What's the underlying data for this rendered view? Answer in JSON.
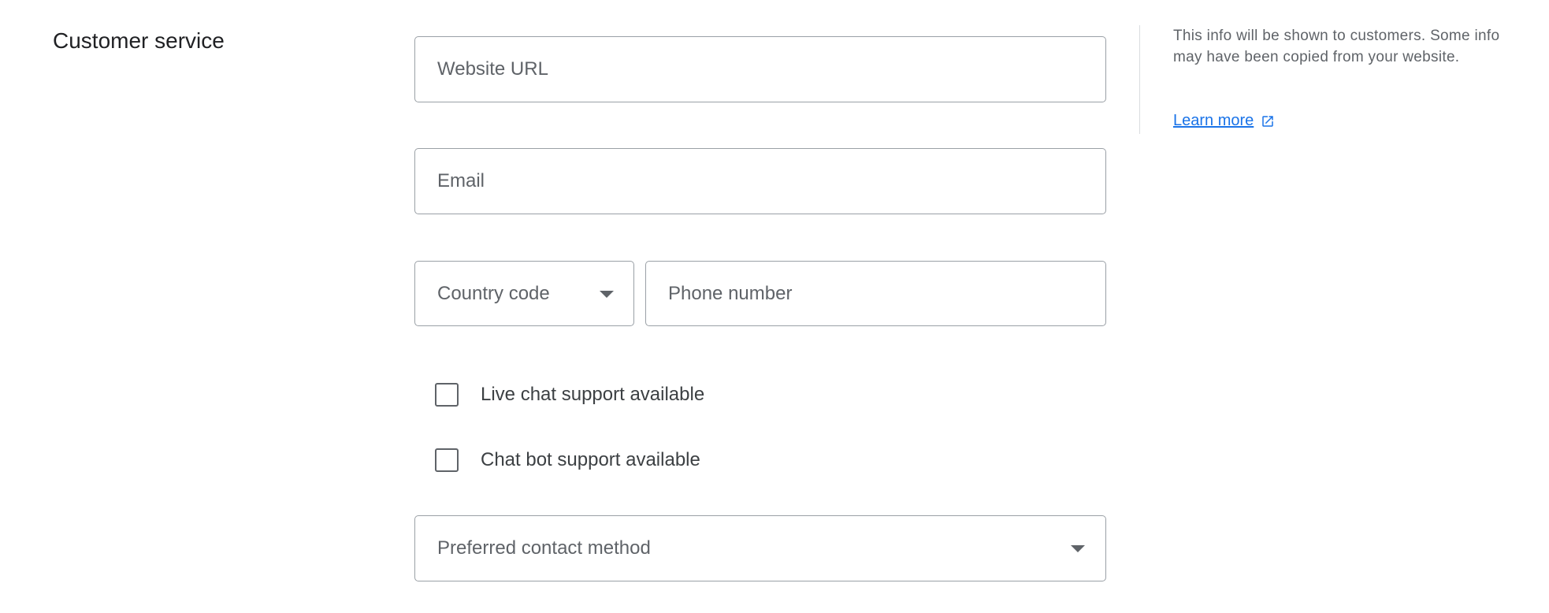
{
  "section": {
    "title": "Customer service"
  },
  "fields": {
    "website_url": {
      "placeholder": "Website URL",
      "value": ""
    },
    "email": {
      "placeholder": "Email",
      "value": ""
    },
    "country_code": {
      "label": "Country code",
      "icon": "chevron-down-icon"
    },
    "phone_number": {
      "placeholder": "Phone number",
      "value": ""
    },
    "preferred_contact": {
      "label": "Preferred contact method",
      "icon": "chevron-down-icon"
    }
  },
  "checkboxes": [
    {
      "label": "Live chat support available",
      "checked": false
    },
    {
      "label": "Chat bot support available",
      "checked": false
    }
  ],
  "help": {
    "text": "This info will be shown to customers. Some info may have been copied from your website.",
    "link_label": "Learn more",
    "link_icon": "external-link-icon"
  },
  "colors": {
    "link": "#1a73e8",
    "border": "#9aa0a6",
    "text": "#202124",
    "muted": "#5f6368"
  }
}
